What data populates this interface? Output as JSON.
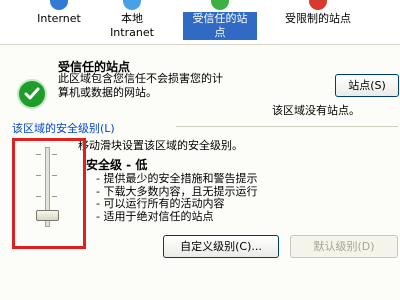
{
  "zones": [
    {
      "label": "Internet",
      "color": "#2f7bd6",
      "selected": false
    },
    {
      "label": "本地\nIntranet",
      "color": "#4aa0e6",
      "selected": false
    },
    {
      "label": "受信任的站\n点",
      "color": "#3cb043",
      "selected": true
    },
    {
      "label": "受限制的站点",
      "color": "#d83a2e",
      "selected": false
    }
  ],
  "trusted": {
    "title": "受信任的站点",
    "description_line1": "此区域包含您信任不会损害您的计",
    "description_line2": "算机或数据的网站。",
    "sites_button": "站点(S)",
    "no_sites_text": "该区域没有站点。"
  },
  "security_level": {
    "group_label": "该区域的安全级别(L)",
    "move_slider_text": "移动滑块设置该区域的安全级别。",
    "level_title": "安全级 - 低",
    "level_fraction": 0.0,
    "bullets": [
      "- 提供最少的安全措施和警告提示",
      "- 下载大多数内容，且无提示运行",
      "- 可以运行所有的活动内容",
      "- 适用于绝对信任的站点"
    ],
    "custom_button": "自定义级别(C)...",
    "default_button": "默认级别(D)"
  }
}
